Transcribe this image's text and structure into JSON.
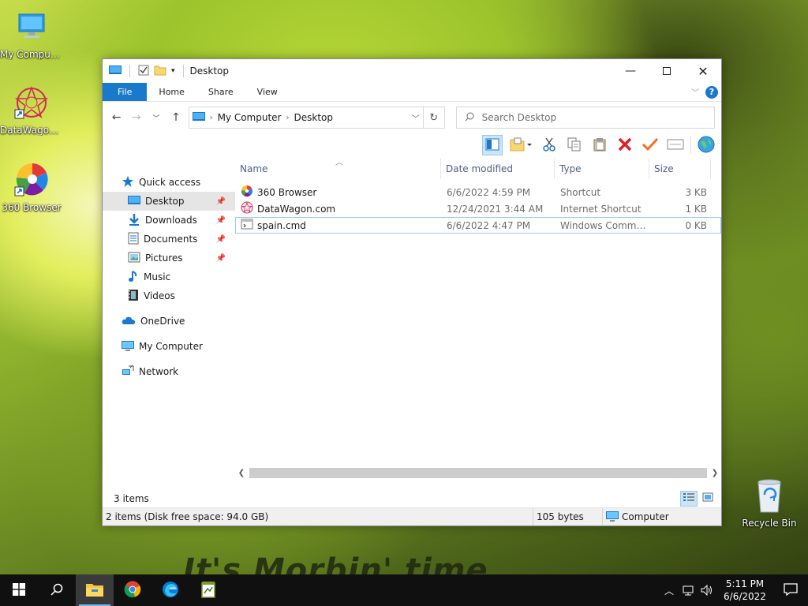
{
  "desktop": {
    "icons": [
      {
        "label": "My Computer",
        "icon": "computer-icon"
      },
      {
        "label": "DataWagon.com",
        "icon": "datawagon-icon"
      },
      {
        "label": "360 Browser",
        "icon": "360-browser-icon"
      },
      {
        "label": "Recycle Bin",
        "icon": "recycle-bin-icon"
      }
    ],
    "caption": "It's Morbin' time."
  },
  "window": {
    "title": "Desktop",
    "ribbon": {
      "tabs": [
        "File",
        "Home",
        "Share",
        "View"
      ]
    },
    "address": {
      "segments": [
        "My Computer",
        "Desktop"
      ]
    },
    "search": {
      "placeholder": "Search Desktop"
    },
    "nav": {
      "items": [
        {
          "label": "Quick access",
          "icon": "star-icon",
          "level": 1
        },
        {
          "label": "Desktop",
          "icon": "desktop-folder-icon",
          "level": 2,
          "pinned": true,
          "selected": true
        },
        {
          "label": "Downloads",
          "icon": "download-icon",
          "level": 2,
          "pinned": true
        },
        {
          "label": "Documents",
          "icon": "documents-icon",
          "level": 2,
          "pinned": true
        },
        {
          "label": "Pictures",
          "icon": "pictures-icon",
          "level": 2,
          "pinned": true
        },
        {
          "label": "Music",
          "icon": "music-icon",
          "level": 2
        },
        {
          "label": "Videos",
          "icon": "videos-icon",
          "level": 2
        },
        {
          "label": "OneDrive",
          "icon": "cloud-icon",
          "level": 1
        },
        {
          "label": "My Computer",
          "icon": "computer-icon",
          "level": 1
        },
        {
          "label": "Network",
          "icon": "network-icon",
          "level": 1
        }
      ]
    },
    "columns": [
      "Name",
      "Date modified",
      "Type",
      "Size"
    ],
    "files": [
      {
        "name": "360 Browser",
        "date": "6/6/2022 4:59 PM",
        "type": "Shortcut",
        "size": "3 KB",
        "icon": "360-browser-icon"
      },
      {
        "name": "DataWagon.com",
        "date": "12/24/2021 3:44 AM",
        "type": "Internet Shortcut",
        "size": "1 KB",
        "icon": "datawagon-icon"
      },
      {
        "name": "spain.cmd",
        "date": "6/6/2022 4:47 PM",
        "type": "Windows Comma...",
        "size": "0 KB",
        "icon": "cmd-file-icon"
      }
    ],
    "status": {
      "item_count": "3 items",
      "selection": "2 items (Disk free space: 94.0 GB)",
      "size": "105 bytes",
      "location": "Computer"
    }
  },
  "taskbar": {
    "time": "5:11 PM",
    "date": "6/6/2022"
  },
  "colors": {
    "accent": "#1979ca",
    "selection": "#cce4f7",
    "taskbar": "#101010"
  }
}
